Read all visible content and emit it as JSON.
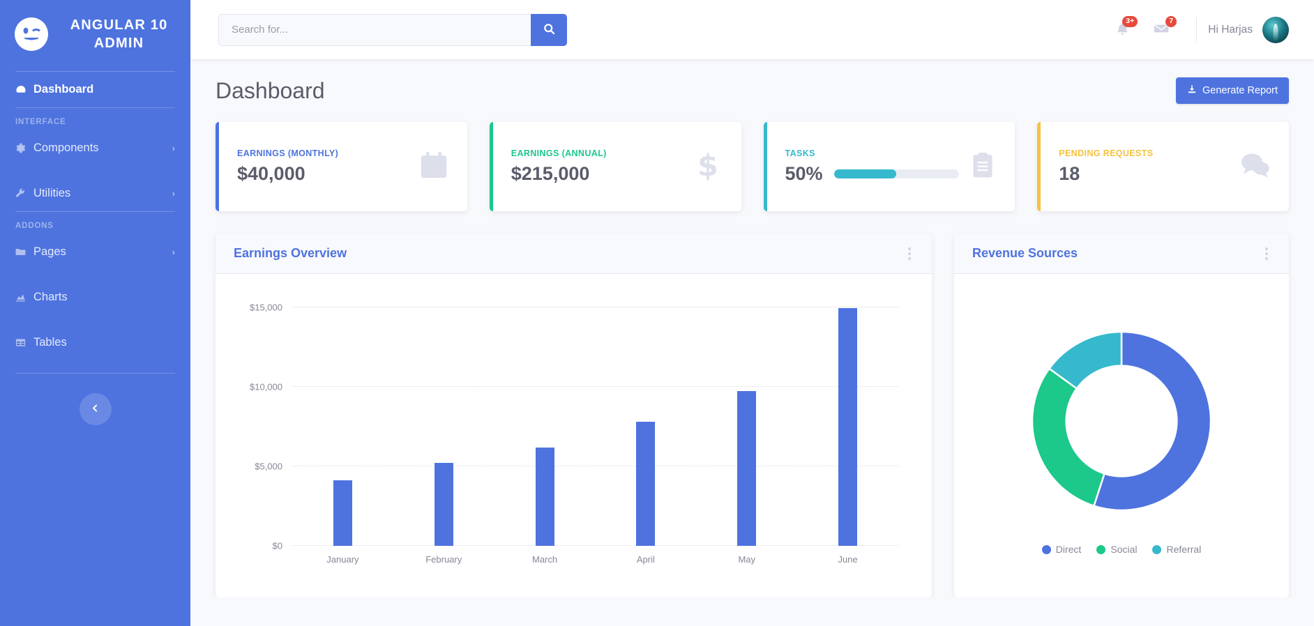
{
  "sidebar": {
    "brand": {
      "logo_icon": "wink-face-icon",
      "title": "Angular 10 Admin"
    },
    "dashboard": {
      "label": "Dashboard",
      "icon": "tachometer-icon"
    },
    "headings": {
      "interface": "Interface",
      "addons": "Addons"
    },
    "items": [
      {
        "label": "Components",
        "icon": "cog-icon",
        "caret": "›"
      },
      {
        "label": "Utilities",
        "icon": "wrench-icon",
        "caret": "›"
      },
      {
        "label": "Pages",
        "icon": "folder-icon",
        "caret": "›"
      },
      {
        "label": "Charts",
        "icon": "chart-area-icon",
        "caret": ""
      },
      {
        "label": "Tables",
        "icon": "table-icon",
        "caret": ""
      }
    ],
    "toggle_icon": "chevron-left-icon"
  },
  "topbar": {
    "search": {
      "placeholder": "Search for...",
      "value": "",
      "button_icon": "search-icon"
    },
    "alerts": {
      "icon": "bell-icon",
      "badge": "3+"
    },
    "messages": {
      "icon": "envelope-icon",
      "badge": "7"
    },
    "user": {
      "greeting": "Hi Harjas",
      "avatar": "user-avatar"
    }
  },
  "page": {
    "title": "Dashboard",
    "generate_report": {
      "label": "Generate Report",
      "icon": "download-icon"
    }
  },
  "stats": [
    {
      "label": "Earnings (Monthly)",
      "value": "$40,000",
      "icon": "calendar-icon",
      "color": "#4e73df",
      "accent": "c-primary",
      "progress": null
    },
    {
      "label": "Earnings (Annual)",
      "value": "$215,000",
      "icon": "dollar-sign-icon",
      "color": "#1cc88a",
      "accent": "c-success",
      "progress": null
    },
    {
      "label": "Tasks",
      "value": "50%",
      "icon": "clipboard-list-icon",
      "color": "#36b9cc",
      "accent": "c-info",
      "progress": 50
    },
    {
      "label": "Pending Requests",
      "value": "18",
      "icon": "comments-icon",
      "color": "#f6c23e",
      "accent": "c-warning",
      "progress": null
    }
  ],
  "cards": {
    "earnings": {
      "title": "Earnings Overview",
      "menu_icon": "kebab-menu-icon"
    },
    "revenue": {
      "title": "Revenue Sources",
      "menu_icon": "kebab-menu-icon"
    }
  },
  "chart_data": [
    {
      "type": "bar",
      "title": "Earnings Overview",
      "categories": [
        "January",
        "February",
        "March",
        "April",
        "May",
        "June"
      ],
      "values": [
        4120,
        5230,
        6170,
        7790,
        9740,
        14960
      ],
      "xlabel": "",
      "ylabel": "",
      "ylim": [
        0,
        15000
      ],
      "yticks": [
        0,
        5000,
        10000,
        15000
      ],
      "ytick_labels": [
        "$0",
        "$5,000",
        "$10,000",
        "$15,000"
      ],
      "bar_color": "#4e73df",
      "grid": true,
      "legend": false
    },
    {
      "type": "pie",
      "subtype": "donut",
      "title": "Revenue Sources",
      "labels": [
        "Direct",
        "Social",
        "Referral"
      ],
      "values": [
        55,
        30,
        15
      ],
      "colors": [
        "#4e73df",
        "#1cc88a",
        "#36b9cc"
      ],
      "legend": "bottom",
      "hole": 0.62
    }
  ]
}
